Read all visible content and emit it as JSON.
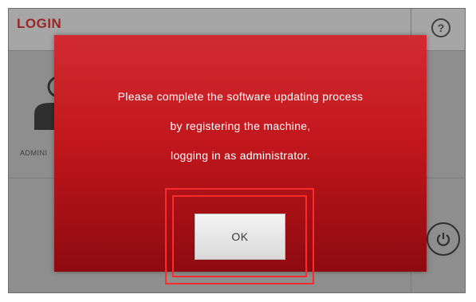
{
  "header": {
    "title": "LOGIN",
    "subtitle": "",
    "help_glyph": "?"
  },
  "user_tile": {
    "label": "ADMINI"
  },
  "dialog": {
    "message_lines": [
      "Please complete the software updating process",
      "by registering the machine,",
      "logging in as administrator."
    ],
    "ok_label": "OK"
  },
  "icons": {
    "help": "help-icon",
    "power": "power-icon",
    "user": "user-icon"
  },
  "colors": {
    "dialog_red": "#c1171c",
    "highlight_red": "#ff2a2a",
    "header_title": "#9a2626"
  }
}
